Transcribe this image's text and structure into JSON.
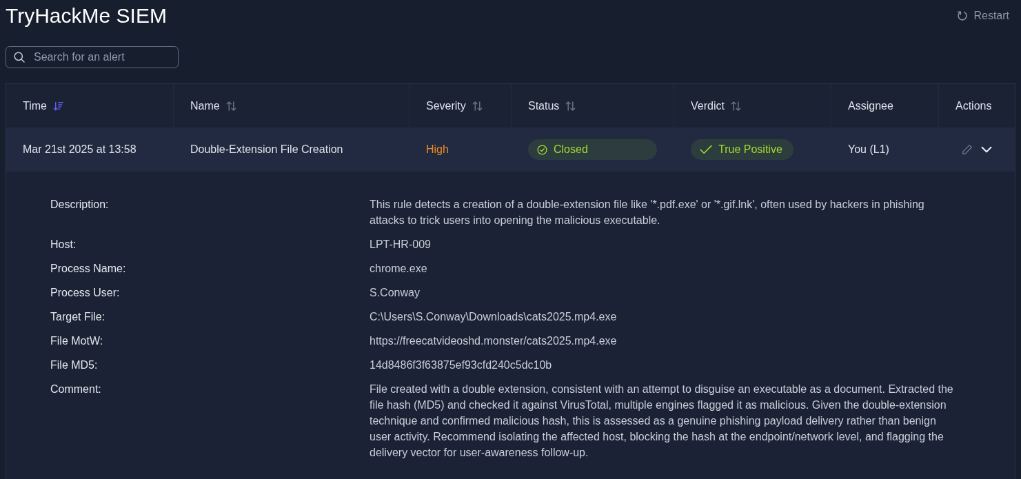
{
  "header": {
    "title": "TryHackMe SIEM",
    "restart_label": "Restart"
  },
  "search": {
    "placeholder": "Search for an alert"
  },
  "table": {
    "columns": [
      {
        "label": "Time",
        "sortable": true,
        "sorted": true
      },
      {
        "label": "Name",
        "sortable": true,
        "sorted": false
      },
      {
        "label": "Severity",
        "sortable": true,
        "sorted": false
      },
      {
        "label": "Status",
        "sortable": true,
        "sorted": false
      },
      {
        "label": "Verdict",
        "sortable": true,
        "sorted": false
      },
      {
        "label": "Assignee",
        "sortable": false,
        "sorted": false
      },
      {
        "label": "Actions",
        "sortable": false,
        "sorted": false
      }
    ],
    "rows": [
      {
        "time": "Mar 21st 2025 at 13:58",
        "name": "Double-Extension File Creation",
        "severity": {
          "label": "High",
          "kind": "high"
        },
        "status": {
          "label": "Closed",
          "kind": "closed"
        },
        "verdict": {
          "label": "True Positive",
          "kind": "true_positive"
        },
        "assignee": "You (L1)",
        "expanded": true,
        "details": [
          {
            "label": "Description:",
            "value": "This rule detects a creation of a double-extension file like '*.pdf.exe' or '*.gif.lnk', often used by hackers in phishing attacks to trick users into opening the malicious executable."
          },
          {
            "label": "Host:",
            "value": "LPT-HR-009"
          },
          {
            "label": "Process Name:",
            "value": "chrome.exe"
          },
          {
            "label": "Process User:",
            "value": "S.Conway"
          },
          {
            "label": "Target File:",
            "value": "C:\\Users\\S.Conway\\Downloads\\cats2025.mp4.exe"
          },
          {
            "label": "File MotW:",
            "value": "https://freecatvideoshd.monster/cats2025.mp4.exe"
          },
          {
            "label": "File MD5:",
            "value": "14d8486f3f63875ef93cfd240c5dc10b"
          },
          {
            "label": "Comment:",
            "value": "File created with a double extension, consistent with an attempt to disguise an executable as a document. Extracted the file hash (MD5) and checked it against VirusTotal, multiple engines flagged it as malicious. Given the double-extension technique and confirmed malicious hash, this is assessed as a genuine phishing payload delivery rather than benign user activity. Recommend isolating the affected host, blocking the hash at the endpoint/network level, and flagging the delivery vector for user-awareness follow-up."
          }
        ]
      }
    ]
  }
}
